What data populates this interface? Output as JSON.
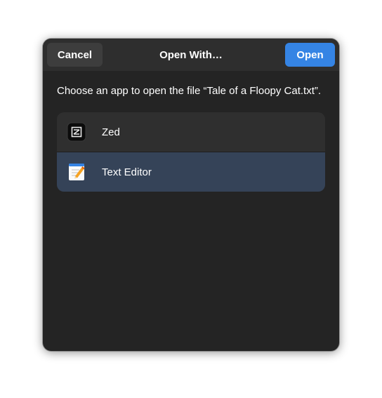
{
  "dialog": {
    "title": "Open With…",
    "cancel_label": "Cancel",
    "open_label": "Open",
    "description": "Choose an app to open the file “Tale of a Floopy Cat.txt”."
  },
  "apps": [
    {
      "name": "Zed",
      "icon": "zed-app-icon",
      "selected": false
    },
    {
      "name": "Text Editor",
      "icon": "text-editor-app-icon",
      "selected": true
    }
  ],
  "colors": {
    "accent": "#3584e4",
    "dialog_bg": "#242424",
    "selected_row": "#354358"
  }
}
